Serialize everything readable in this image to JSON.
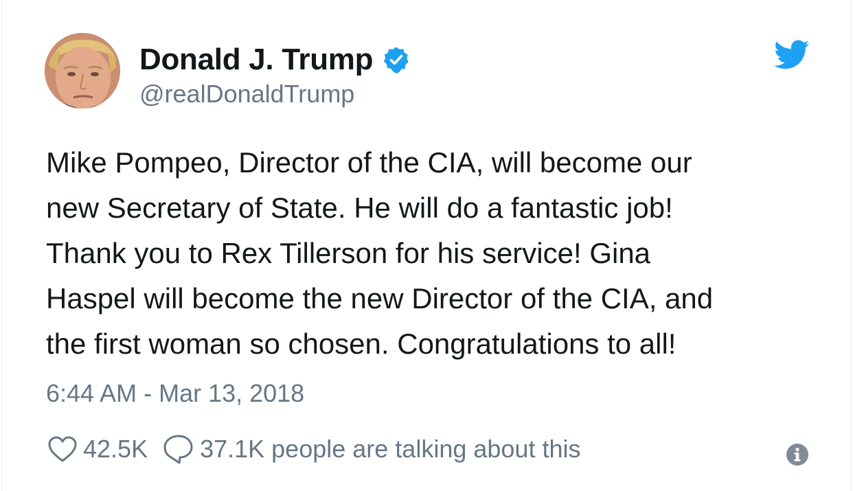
{
  "author": {
    "display_name": "Donald J. Trump",
    "handle": "@realDonaldTrump",
    "verified": true
  },
  "tweet": {
    "text": "Mike Pompeo, Director of the CIA, will become our\nnew Secretary of State. He will do a fantastic job!\nThank you to Rex Tillerson for his service! Gina\nHaspel will become the new Director of the CIA, and\nthe first woman so chosen. Congratulations to all!",
    "timestamp": "6:44 AM - Mar 13, 2018"
  },
  "stats": {
    "likes": "42.5K",
    "talking": "37.1K people are talking about this"
  },
  "icons": {
    "brand": "twitter-bird-icon",
    "verified": "verified-badge-icon",
    "like": "heart-icon",
    "reply": "speech-bubble-icon",
    "info": "info-icon"
  },
  "colors": {
    "brand_blue": "#1da1f2",
    "text": "#14171a",
    "secondary": "#657786"
  }
}
